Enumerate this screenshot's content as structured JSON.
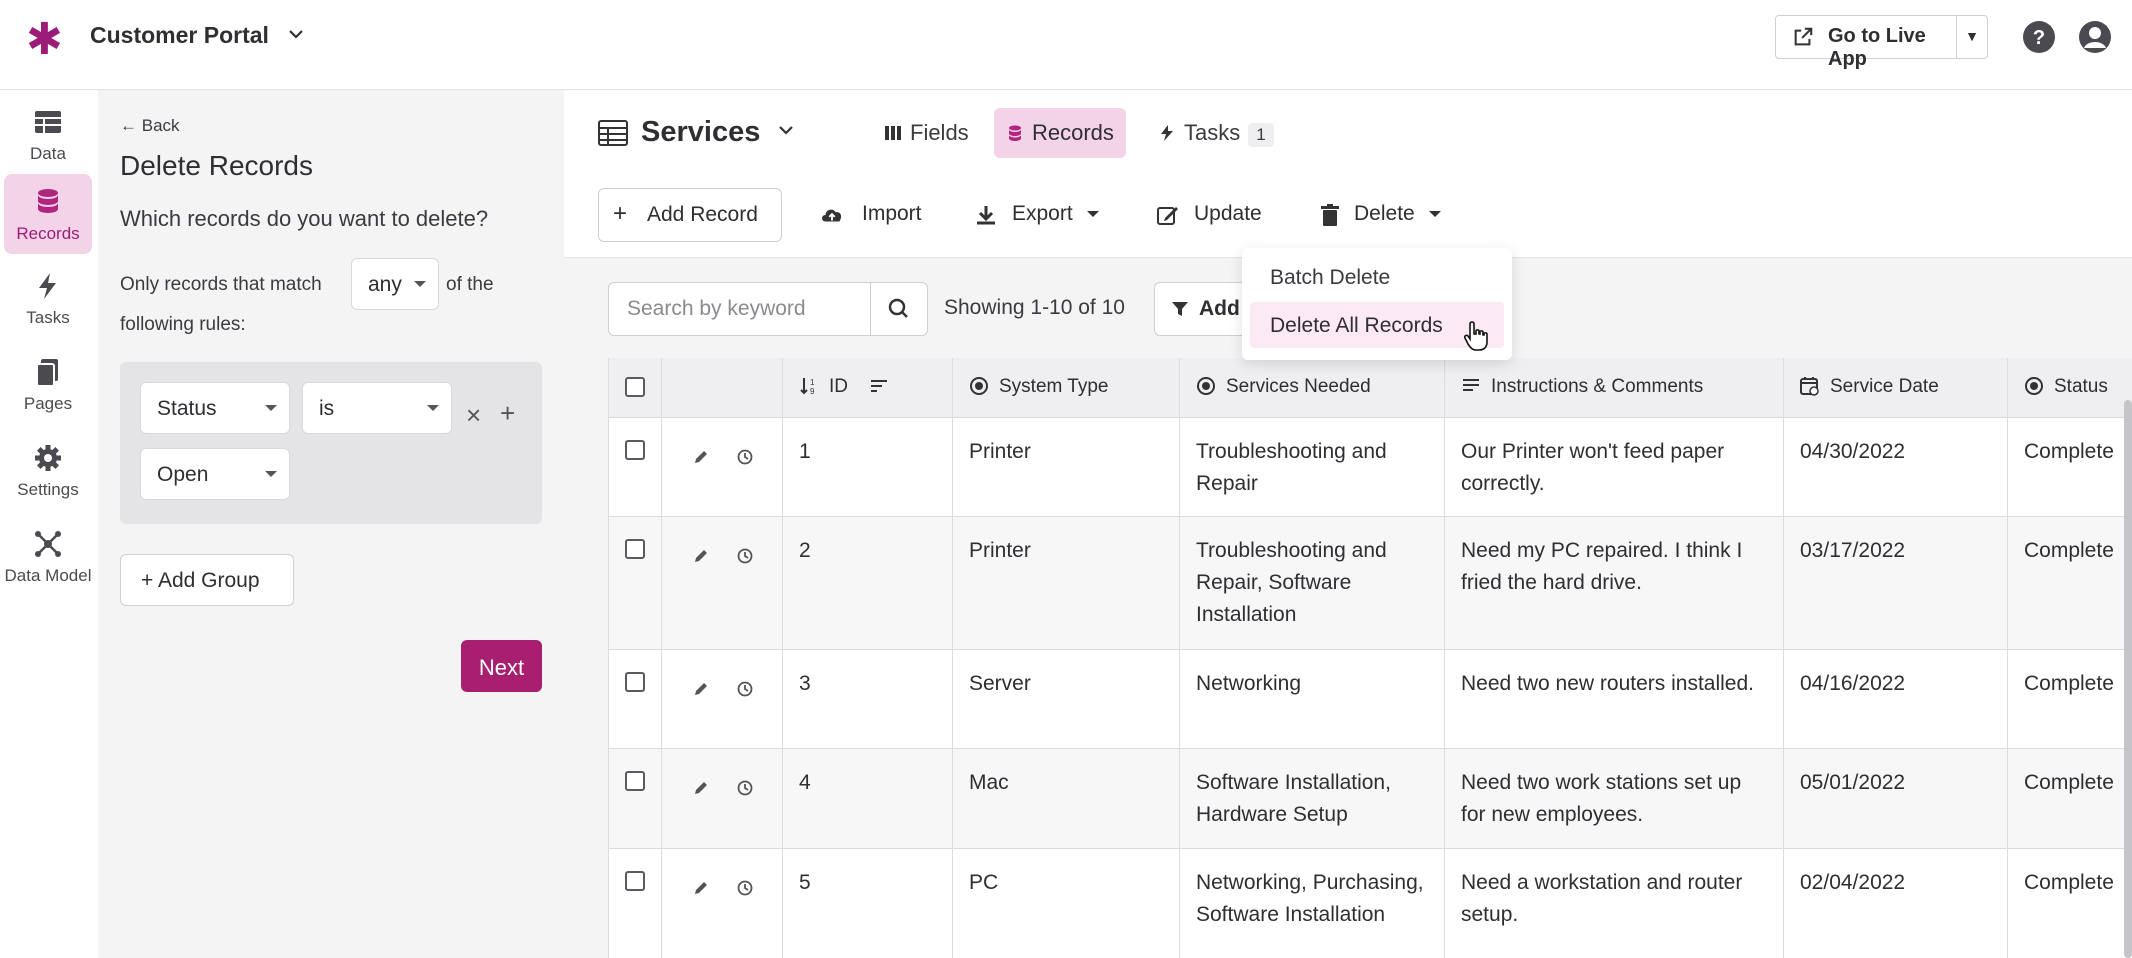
{
  "header": {
    "app_name": "Customer Portal",
    "live_app_label": "Go to Live App",
    "icons": [
      "asterisk-logo",
      "chevron-down-icon",
      "external-link-icon",
      "help-icon",
      "user-icon"
    ]
  },
  "rail": {
    "items": [
      {
        "label": "Data",
        "icon": "table-icon"
      },
      {
        "label": "Records",
        "icon": "database-icon",
        "active": true
      },
      {
        "label": "Tasks",
        "icon": "bolt-icon"
      },
      {
        "label": "Pages",
        "icon": "pages-icon"
      },
      {
        "label": "Settings",
        "icon": "gear-icon"
      },
      {
        "label": "Data Model",
        "icon": "model-icon"
      }
    ]
  },
  "panel": {
    "back_label": "Back",
    "title": "Delete Records",
    "question": "Which records do you want to delete?",
    "match_pre": "Only records that match",
    "match_value": "any",
    "match_post": "of the",
    "match_post2": "following rules:",
    "rule": {
      "field": "Status",
      "operator": "is",
      "value": "Open"
    },
    "add_group_label": "+ Add Group",
    "next_label": "Next"
  },
  "main": {
    "table_name": "Services",
    "tabs": [
      {
        "label": "Fields",
        "icon": "columns-icon"
      },
      {
        "label": "Records",
        "icon": "database-icon",
        "active": true
      },
      {
        "label": "Tasks",
        "icon": "bolt-icon",
        "badge": "1"
      }
    ],
    "toolbar": {
      "add_record": "Add Record",
      "import": "Import",
      "export": "Export",
      "update": "Update",
      "delete": "Delete"
    },
    "search_placeholder": "Search by keyword",
    "showing": "Showing 1-10 of 10",
    "add_filter": "Add"
  },
  "dropdown": {
    "items": [
      "Batch Delete",
      "Delete All Records"
    ],
    "highlighted": 1
  },
  "table": {
    "columns": [
      {
        "label": "ID",
        "icon": "sort-number-icon"
      },
      {
        "label": "System Type",
        "icon": "radio-icon"
      },
      {
        "label": "Services Needed",
        "icon": "radio-icon"
      },
      {
        "label": "Instructions & Comments",
        "icon": "paragraph-icon"
      },
      {
        "label": "Service Date",
        "icon": "calendar-icon"
      },
      {
        "label": "Status",
        "icon": "radio-icon"
      }
    ],
    "rows": [
      {
        "id": "1",
        "system": "Printer",
        "services": "Troubleshooting and Repair",
        "comments": "Our Printer won't feed paper correctly.",
        "date": "04/30/2022",
        "status": "Complete"
      },
      {
        "id": "2",
        "system": "Printer",
        "services": "Troubleshooting and Repair, Software Installation",
        "comments": "Need my PC repaired. I think I fried the hard drive.",
        "date": "03/17/2022",
        "status": "Complete"
      },
      {
        "id": "3",
        "system": "Server",
        "services": "Networking",
        "comments": "Need two new routers installed.",
        "date": "04/16/2022",
        "status": "Complete"
      },
      {
        "id": "4",
        "system": "Mac",
        "services": "Software Installation, Hardware Setup",
        "comments": "Need two work stations set up for new employees.",
        "date": "05/01/2022",
        "status": "Complete"
      },
      {
        "id": "5",
        "system": "PC",
        "services": "Networking, Purchasing, Software Installation",
        "comments": "Need a workstation and router setup.",
        "date": "02/04/2022",
        "status": "Complete"
      }
    ]
  },
  "colors": {
    "brand": "#9c1d78",
    "active_bg": "#f3d3e7",
    "next_button": "#a81f6f"
  }
}
